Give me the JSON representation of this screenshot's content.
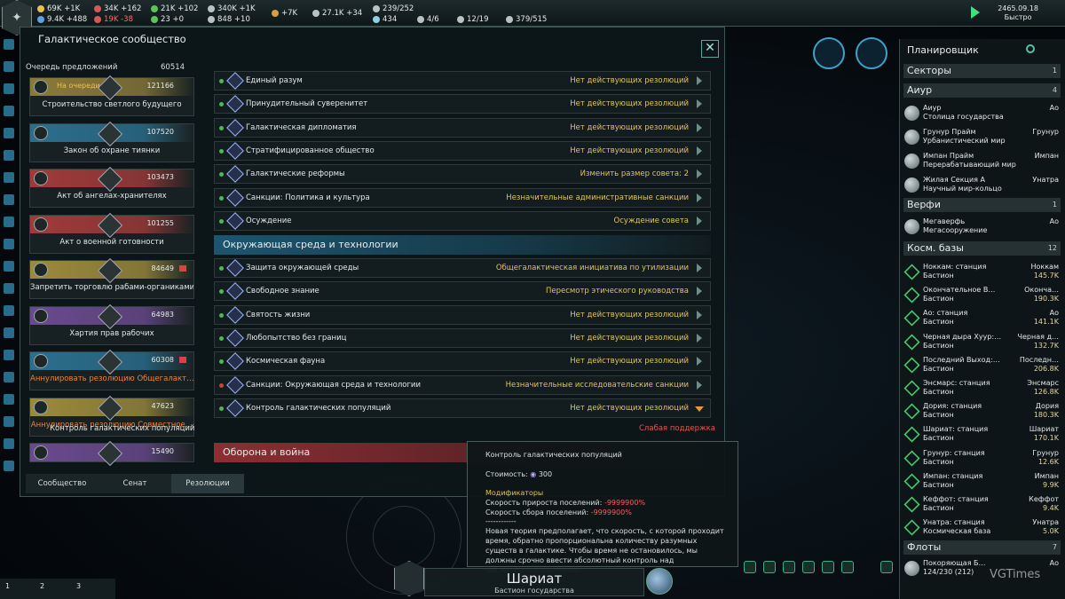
{
  "topbar": {
    "resources": [
      {
        "value": "69K +1K",
        "color": "#e6c24a"
      },
      {
        "value": "34K +162",
        "color": "#d35a5a"
      },
      {
        "value": "21K +102",
        "color": "#5cc25a"
      },
      {
        "value": "340K +1K",
        "color": "#b8c4c2"
      },
      {
        "value": "9.4K +488",
        "color": "#60a0e0"
      },
      {
        "value": "19K -38",
        "color": "#d35a5a"
      },
      {
        "value": "23 +0",
        "color": "#5cc25a"
      },
      {
        "value": "848 +10",
        "color": "#b8c4c2"
      },
      {
        "value": "+7K",
        "color": "#d6a040"
      },
      {
        "value": "27.1K +34",
        "color": "#b8c4c2"
      },
      {
        "value": "239/252",
        "color": "#b8c4c2"
      },
      {
        "value": "434",
        "color": "#8fd0e8"
      },
      {
        "value": "4/6",
        "color": "#b8c4c2"
      },
      {
        "value": "12/19",
        "color": "#b8c4c2"
      },
      {
        "value": "379/515",
        "color": "#b8c4c2"
      }
    ],
    "date": "2465.09.18",
    "speed": "Быстро"
  },
  "window": {
    "title": "Галактическое сообщество",
    "close_glyph": "✕"
  },
  "queue": {
    "header": "Очередь предложений",
    "influence": "60514",
    "status_first": "На очереди",
    "items": [
      {
        "votes": "121166",
        "label": "Строительство светлого будущего",
        "band": "#8a7a3a",
        "flag": false,
        "warn": false
      },
      {
        "votes": "107520",
        "label": "Закон об охране тиянки",
        "band": "#2b6f8e",
        "flag": false,
        "warn": false
      },
      {
        "votes": "103473",
        "label": "Акт об ангелах-хранителях",
        "band": "#a13a3a",
        "flag": false,
        "warn": false
      },
      {
        "votes": "101255",
        "label": "Акт о военной готовности",
        "band": "#a13a3a",
        "flag": false,
        "warn": false
      },
      {
        "votes": "84649",
        "label": "Запретить торговлю рабами-органиками",
        "band": "#9c8a3c",
        "flag": true,
        "warn": false
      },
      {
        "votes": "64983",
        "label": "Хартия прав рабочих",
        "band": "#6a4a8e",
        "flag": false,
        "warn": false
      },
      {
        "votes": "60308",
        "label": "Аннулировать резолюцию Общегалакт…",
        "band": "#2b6f8e",
        "flag": true,
        "warn": true
      },
      {
        "votes": "47623",
        "label": "Аннулировать резолюцию Совместное…",
        "band": "#9c8a3c",
        "flag": false,
        "warn": true
      },
      {
        "votes": "15490",
        "label": "",
        "band": "#6a4a8e",
        "flag": false,
        "warn": false
      }
    ],
    "tabs": [
      "Сообщество",
      "Сенат",
      "Резолюции"
    ]
  },
  "resolutions": {
    "rows_a": [
      {
        "name": "Единый разум",
        "value": "Нет действующих резолюций",
        "dot": "g"
      },
      {
        "name": "Принудительный суверенитет",
        "value": "Нет действующих резолюций",
        "dot": "g"
      },
      {
        "name": "Галактическая дипломатия",
        "value": "Нет действующих резолюций",
        "dot": "g"
      },
      {
        "name": "Стратифицированное общество",
        "value": "Нет действующих резолюций",
        "dot": "g"
      },
      {
        "name": "Галактические реформы",
        "value": "Изменить размер совета: 2",
        "dot": "g"
      },
      {
        "name": "Санкции: Политика и культура",
        "value": "Незначительные административные санкции",
        "dot": "g"
      },
      {
        "name": "Осуждение",
        "value": "Осуждение совета",
        "dot": "g"
      }
    ],
    "section_env": "Окружающая среда и технологии",
    "rows_b": [
      {
        "name": "Защита окружающей среды",
        "value": "Общегалактическая инициатива по утилизации",
        "dot": "g"
      },
      {
        "name": "Свободное знание",
        "value": "Пересмотр этического руководства",
        "dot": "g"
      },
      {
        "name": "Святость жизни",
        "value": "Нет действующих резолюций",
        "dot": "g"
      },
      {
        "name": "Любопытство без границ",
        "value": "Нет действующих резолюций",
        "dot": "g"
      },
      {
        "name": "Космическая фауна",
        "value": "Нет действующих резолюций",
        "dot": "g"
      },
      {
        "name": "Санкции: Окружающая среда и технологии",
        "value": "Незначительные исследовательские санкции",
        "dot": "r"
      },
      {
        "name": "Контроль галактических популяций",
        "value": "Нет действующих резолюций",
        "dot": "g"
      }
    ],
    "sub_label": "Контроль галактических популяций",
    "sub_value": "Слабая поддержка",
    "section_war": "Оборона и война"
  },
  "tooltip": {
    "title": "Контроль галактических популяций",
    "cost_label": "Стоимость:",
    "cost": "300",
    "modifiers_label": "Модификаторы",
    "mod1_label": "Скорость прироста поселений:",
    "mod1_value": "-9999900%",
    "mod2_label": "Скорость сбора поселений:",
    "mod2_value": "-9999900%",
    "separator": "------------",
    "description": "Новая теория предполагает, что скорость, с которой проходит время, обратно пропорциональна количеству разумных существ в галактике. Чтобы время не остановилось, мы должны срочно ввести абсолютный контроль над численностью населения."
  },
  "planner": {
    "title": "Планировщик",
    "sectors": {
      "label": "Секторы",
      "count": "1"
    },
    "sector_ayur": {
      "label": "Аиур",
      "count": "4"
    },
    "planets": [
      {
        "l1": "Аиур",
        "l2": "Столица государства",
        "r1": "Ао",
        "r2": ""
      },
      {
        "l1": "Грунур Прайм",
        "l2": "Урбанистический мир",
        "r1": "Грунур",
        "r2": ""
      },
      {
        "l1": "Импан Прайм",
        "l2": "Перерабатывающий мир",
        "r1": "Импан",
        "r2": ""
      },
      {
        "l1": "Жилая Секция А",
        "l2": "Научный мир-кольцо",
        "r1": "Унатра",
        "r2": ""
      }
    ],
    "shipyards": {
      "label": "Верфи",
      "count": "1"
    },
    "shipyard_rows": [
      {
        "l1": "Мегаверфь",
        "l2": "Мегасооружение",
        "r1": "Ао",
        "r2": ""
      }
    ],
    "starbases": {
      "label": "Косм. базы",
      "count": "12"
    },
    "starbase_rows": [
      {
        "l1": "Ноккам: станция",
        "l2": "Бастион",
        "r1": "Ноккам",
        "r2": "145.7K"
      },
      {
        "l1": "Окончательное В…",
        "l2": "Бастион",
        "r1": "Оконча…",
        "r2": "190.3K"
      },
      {
        "l1": "Ао: станция",
        "l2": "Бастион",
        "r1": "Ао",
        "r2": "141.1K"
      },
      {
        "l1": "Черная дыра Хуур:…",
        "l2": "Бастион",
        "r1": "Черная д…",
        "r2": "132.7K"
      },
      {
        "l1": "Последний Выход:…",
        "l2": "Бастион",
        "r1": "Последн…",
        "r2": "206.8K"
      },
      {
        "l1": "Энсмарс: станция",
        "l2": "Бастион",
        "r1": "Энсмарс",
        "r2": "126.8K"
      },
      {
        "l1": "Дория: станция",
        "l2": "Бастион",
        "r1": "Дория",
        "r2": "180.3K"
      },
      {
        "l1": "Шариат: станция",
        "l2": "Бастион",
        "r1": "Шариат",
        "r2": "170.1K"
      },
      {
        "l1": "Грунур: станция",
        "l2": "Бастион",
        "r1": "Грунур",
        "r2": "12.6K"
      },
      {
        "l1": "Импан: станция",
        "l2": "Бастион",
        "r1": "Импан",
        "r2": "9.9K"
      },
      {
        "l1": "Кеффот: станция",
        "l2": "Бастион",
        "r1": "Кеффот",
        "r2": "9.4K"
      },
      {
        "l1": "Унатра: станция",
        "l2": "Космическая база",
        "r1": "Унатра",
        "r2": "5.0K"
      }
    ],
    "fleets": {
      "label": "Флоты",
      "count": "7"
    },
    "fleet_rows": [
      {
        "l1": "Покоряющая Б…",
        "l2": "124/230 (212)",
        "r1": "Ао",
        "r2": ""
      }
    ]
  },
  "bottom": {
    "group1": "1",
    "group2": "2",
    "group3": "3",
    "capital_name": "Шариат",
    "capital_sub": "Бастион государства",
    "watermark": "VGTimes"
  }
}
